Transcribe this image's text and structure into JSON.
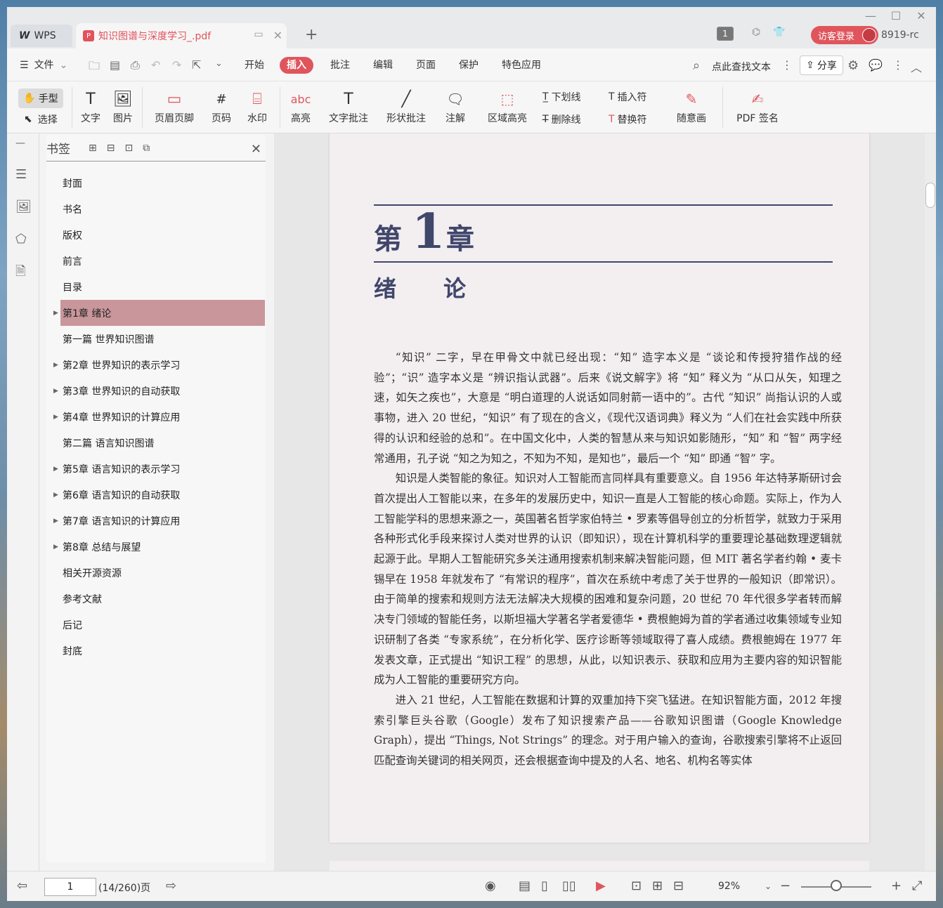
{
  "app": {
    "name": "WPS"
  },
  "tab": {
    "title": "知识图谱与深度学习_.pdf"
  },
  "titlebar": {
    "page_count": "1",
    "login": "访客登录",
    "user_id": "8919-rc"
  },
  "menu": {
    "file": "文件",
    "items": [
      "开始",
      "插入",
      "批注",
      "编辑",
      "页面",
      "保护",
      "特色应用"
    ],
    "active": "插入",
    "search": "点此查找文本",
    "share": "分享"
  },
  "ribbon": {
    "hand": "手型",
    "select": "选择",
    "text": "文字",
    "image": "图片",
    "header_footer": "页眉页脚",
    "page_num": "页码",
    "watermark": "水印",
    "highlight": "高亮",
    "text_comment": "文字批注",
    "shape_comment": "形状批注",
    "annotation": "注解",
    "area_highlight": "区域高亮",
    "underline": "下划线",
    "strikethrough": "删除线",
    "insert_char": "插入符",
    "replace_char": "替换符",
    "freehand": "随意画",
    "pdf_sign": "PDF 签名"
  },
  "sidebar": {
    "title": "书签",
    "items": [
      {
        "label": "封面",
        "expandable": false
      },
      {
        "label": "书名",
        "expandable": false
      },
      {
        "label": "版权",
        "expandable": false
      },
      {
        "label": "前言",
        "expandable": false
      },
      {
        "label": "目录",
        "expandable": false
      },
      {
        "label": "第1章 绪论",
        "expandable": true,
        "active": true
      },
      {
        "label": "第一篇 世界知识图谱",
        "expandable": false
      },
      {
        "label": "第2章 世界知识的表示学习",
        "expandable": true
      },
      {
        "label": "第3章 世界知识的自动获取",
        "expandable": true
      },
      {
        "label": "第4章 世界知识的计算应用",
        "expandable": true
      },
      {
        "label": "第二篇 语言知识图谱",
        "expandable": false
      },
      {
        "label": "第5章 语言知识的表示学习",
        "expandable": true
      },
      {
        "label": "第6章 语言知识的自动获取",
        "expandable": true
      },
      {
        "label": "第7章 语言知识的计算应用",
        "expandable": true
      },
      {
        "label": "第8章 总结与展望",
        "expandable": true
      },
      {
        "label": "相关开源资源",
        "expandable": false
      },
      {
        "label": "参考文献",
        "expandable": false
      },
      {
        "label": "后记",
        "expandable": false
      },
      {
        "label": "封底",
        "expandable": false
      }
    ]
  },
  "document": {
    "chapter_di": "第",
    "chapter_num": "1",
    "chapter_zhang": "章",
    "chapter_title": "绪 论",
    "paragraphs": [
      "“知识” 二字，早在甲骨文中就已经出现：“知” 造字本义是 “谈论和传授狩猎作战的经验”；“识” 造字本义是 “辨识指认武器”。后来《说文解字》将 “知” 释义为 “从口从矢，知理之速，如矢之疾也”，大意是 “明白道理的人说话如同射箭一语中的”。古代 “知识” 尚指认识的人或事物，进入 20 世纪，“知识” 有了现在的含义，《现代汉语词典》释义为 “人们在社会实践中所获得的认识和经验的总和”。在中国文化中，人类的智慧从来与知识如影随形，“知” 和 “智” 两字经常通用，孔子说 “知之为知之，不知为不知，是知也”，最后一个 “知” 即通 “智” 字。",
      "知识是人类智能的象征。知识对人工智能而言同样具有重要意义。自 1956 年达特茅斯研讨会首次提出人工智能以来，在多年的发展历史中，知识一直是人工智能的核心命题。实际上，作为人工智能学科的思想来源之一，英国著名哲学家伯特兰 • 罗素等倡导创立的分析哲学，就致力于采用各种形式化手段来探讨人类对世界的认识（即知识），现在计算机科学的重要理论基础数理逻辑就起源于此。早期人工智能研究多关注通用搜索机制来解决智能问题，但 MIT 著名学者约翰 • 麦卡锡早在 1958 年就发布了 “有常识的程序”，首次在系统中考虑了关于世界的一般知识（即常识）。由于简单的搜索和规则方法无法解决大规模的困难和复杂问题，20 世纪 70 年代很多学者转而解决专门领域的智能任务，以斯坦福大学著名学者爱德华 • 费根鲍姆为首的学者通过收集领域专业知识研制了各类 “专家系统”，在分析化学、医疗诊断等领域取得了喜人成绩。费根鲍姆在 1977 年发表文章，正式提出 “知识工程” 的思想，从此，以知识表示、获取和应用为主要内容的知识智能成为人工智能的重要研究方向。",
      "进入 21 世纪，人工智能在数据和计算的双重加持下突飞猛进。在知识智能方面，2012 年搜索引擎巨头谷歌（Google）发布了知识搜索产品——谷歌知识图谱（Google Knowledge Graph），提出 “Things, Not Strings” 的理念。对于用户输入的查询，谷歌搜索引擎将不止返回匹配查询关键词的相关网页，还会根据查询中提及的人名、地名、机构名等实体"
    ]
  },
  "status": {
    "page_input": "1",
    "page_total": "(14/260)页",
    "zoom": "92%"
  },
  "colors": {
    "accent": "#e0555c",
    "active_bookmark": "#c9969c",
    "chapter": "#41466b"
  }
}
